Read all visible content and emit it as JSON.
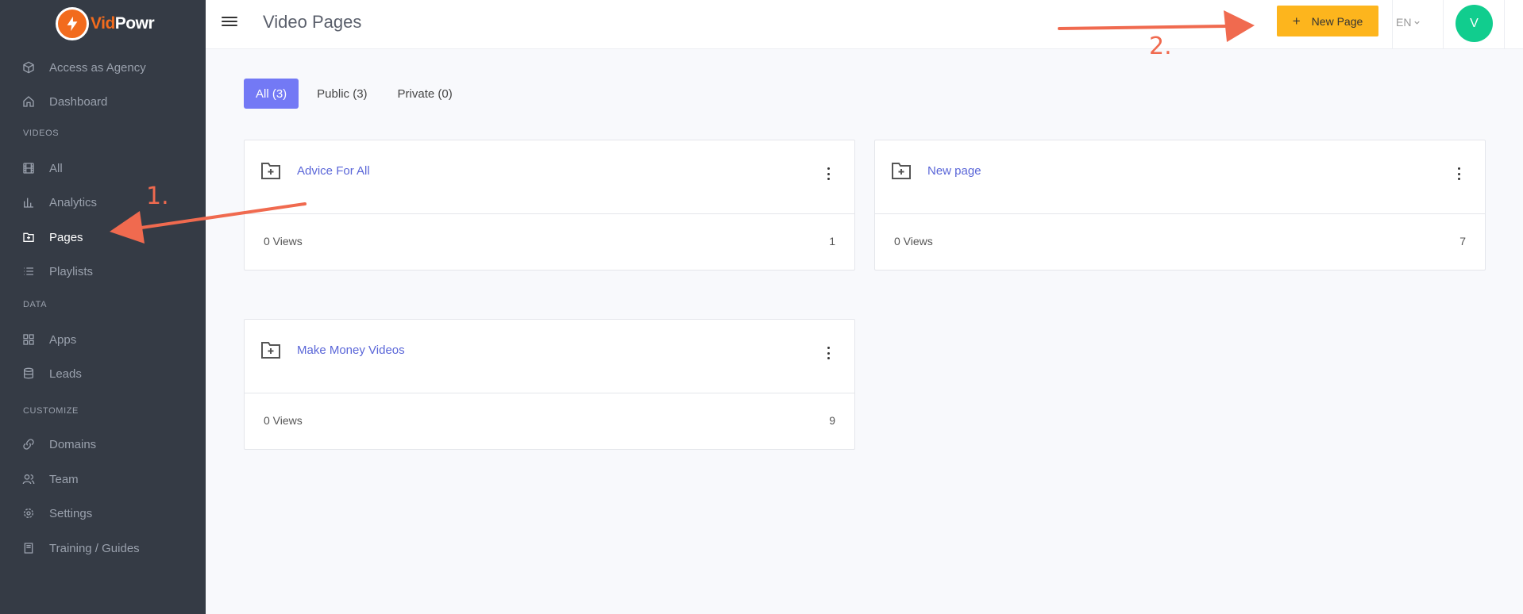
{
  "brand": {
    "name_part1": "Vid",
    "name_part2": "Powr",
    "accent": "#f26b1d"
  },
  "sidebar": {
    "items": [
      {
        "label": "Access as Agency",
        "icon": "cube-icon"
      },
      {
        "label": "Dashboard",
        "icon": "home-icon"
      },
      {
        "label": "All",
        "icon": "film-icon"
      },
      {
        "label": "Analytics",
        "icon": "bar-chart-icon"
      },
      {
        "label": "Pages",
        "icon": "folder-plus-icon",
        "active": true
      },
      {
        "label": "Playlists",
        "icon": "list-icon"
      },
      {
        "label": "Apps",
        "icon": "grid-icon"
      },
      {
        "label": "Leads",
        "icon": "database-icon"
      },
      {
        "label": "Domains",
        "icon": "link-icon"
      },
      {
        "label": "Team",
        "icon": "users-icon"
      },
      {
        "label": "Settings",
        "icon": "gear-icon"
      },
      {
        "label": "Training / Guides",
        "icon": "book-icon"
      }
    ],
    "sections": {
      "videos": "VIDEOS",
      "data": "DATA",
      "customize": "CUSTOMIZE"
    }
  },
  "header": {
    "title": "Video Pages",
    "new_button": {
      "icon": "+",
      "label": "New Page"
    },
    "language": "EN",
    "avatar_initial": "V"
  },
  "tabs": [
    {
      "label": "All (3)",
      "active": true
    },
    {
      "label": "Public (3)"
    },
    {
      "label": "Private (0)"
    }
  ],
  "cards": [
    {
      "title": "Advice For All",
      "views": "0 Views",
      "count": "1"
    },
    {
      "title": "New page",
      "views": "0 Views",
      "count": "7"
    },
    {
      "title": "Make Money Videos",
      "views": "0 Views",
      "count": "9"
    }
  ],
  "annotations": {
    "step1": "1.",
    "step2": "2.",
    "color": "#f06a4f"
  },
  "colors": {
    "sidebar_bg": "#353b45",
    "tab_active": "#7379f5",
    "button": "#fdb51d",
    "avatar": "#11cd8e",
    "link": "#5a66d8"
  }
}
